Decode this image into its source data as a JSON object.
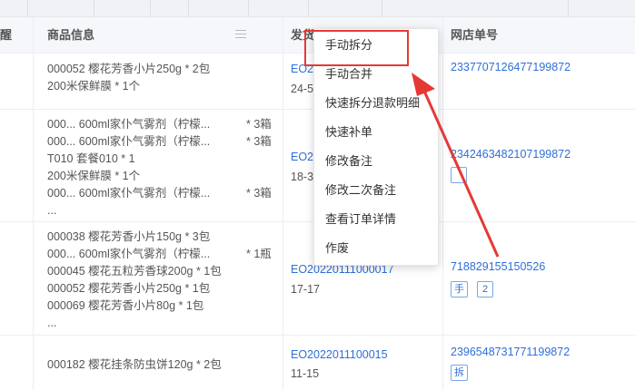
{
  "colors": {
    "link": "#2f6fd6",
    "annotation": "#e53935",
    "header_bg": "#f5f7fa"
  },
  "header": {
    "col_partial": "醒",
    "col_goods": "商品信息",
    "col_ship": "发货",
    "col_store_order": "网店单号"
  },
  "rows": [
    {
      "goods": [
        {
          "name": "000052 樱花芳香小片250g * 2包",
          "qty": ""
        },
        {
          "name": " 200米保鲜膜 * 1个",
          "qty": ""
        }
      ],
      "order_no": "EO2",
      "sub": "24-5",
      "store_no": "2337707126477199872",
      "tags": []
    },
    {
      "goods": [
        {
          "name": "000...  600ml家仆气雾剂（柠檬...",
          "qty": "* 3箱"
        },
        {
          "name": "000...  600ml家仆气雾剂（柠檬...",
          "qty": "* 3箱"
        },
        {
          "name": "T010 套餐010 * 1",
          "qty": ""
        },
        {
          "name": " 200米保鲜膜 * 1个",
          "qty": ""
        },
        {
          "name": "000...  600ml家仆气雾剂（柠檬...",
          "qty": "* 3箱"
        },
        {
          "name": "...",
          "qty": ""
        }
      ],
      "order_no": "EO2",
      "sub": "18-3",
      "store_no": "2342463482107199872",
      "tags": [
        ""
      ]
    },
    {
      "goods": [
        {
          "name": "000038 樱花芳香小片150g * 3包",
          "qty": ""
        },
        {
          "name": "000...  600ml家仆气雾剂（柠檬...",
          "qty": "* 1瓶"
        },
        {
          "name": "000045 樱花五粒芳香球200g * 1包",
          "qty": ""
        },
        {
          "name": "000052 樱花芳香小片250g * 1包",
          "qty": ""
        },
        {
          "name": "000069 樱花芳香小片80g * 1包",
          "qty": ""
        },
        {
          "name": "...",
          "qty": ""
        }
      ],
      "order_no": "EO20220111000017",
      "sub": "17-17",
      "store_no": "718829155150526",
      "tags": [
        "手",
        "2"
      ]
    },
    {
      "goods": [
        {
          "name": "000182 樱花挂条防虫饼120g * 2包",
          "qty": ""
        }
      ],
      "order_no": "EO2022011100015",
      "sub": "11-15",
      "store_no": "2396548731771199872",
      "tags": [
        "拆"
      ]
    }
  ],
  "context_menu": {
    "items": [
      "手动拆分",
      "手动合并",
      "快速拆分退款明细",
      "快速补单",
      "修改备注",
      "修改二次备注",
      "查看订单详情",
      "作废"
    ]
  }
}
